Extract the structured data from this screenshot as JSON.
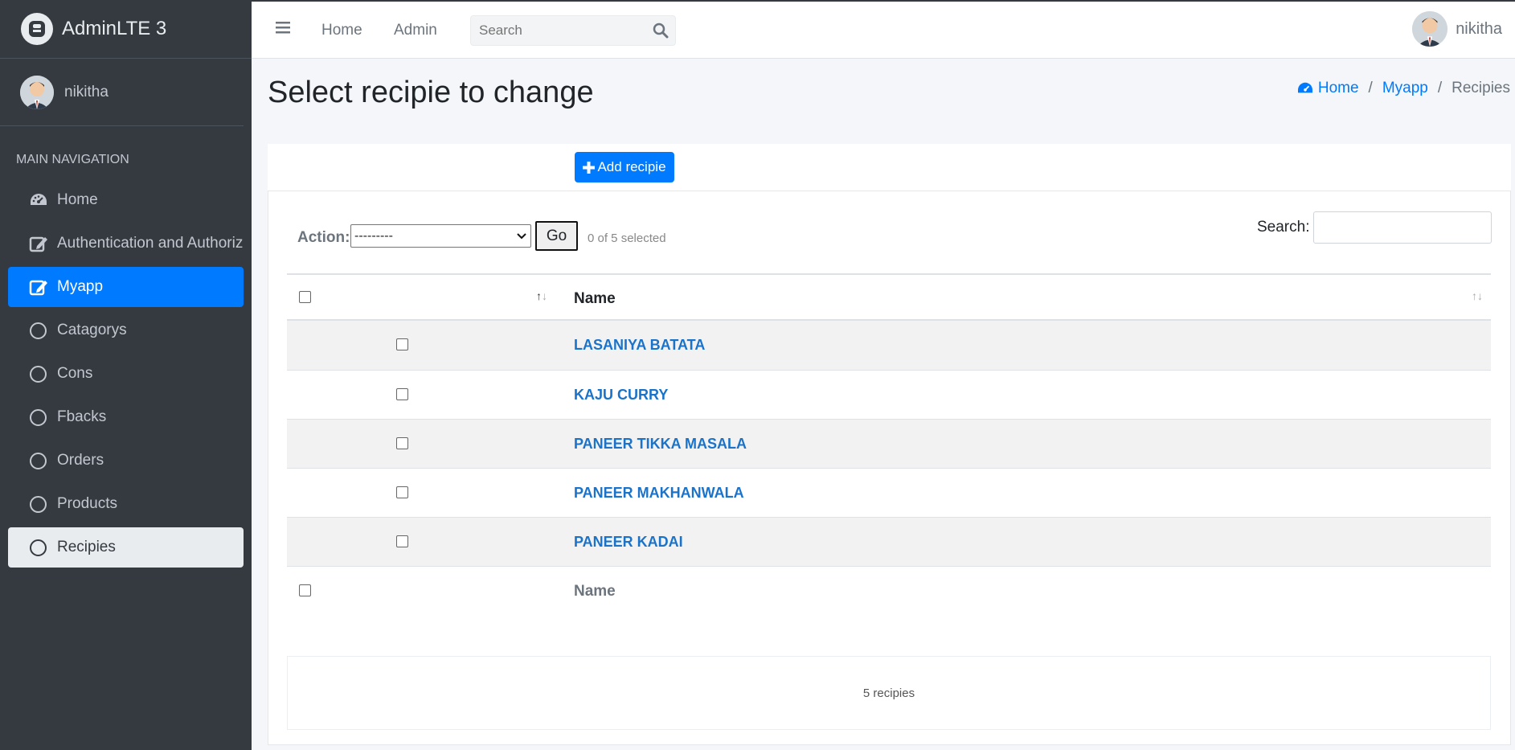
{
  "brand": {
    "title": "AdminLTE 3"
  },
  "user": {
    "name": "nikitha"
  },
  "sidebar": {
    "header": "MAIN NAVIGATION",
    "items": [
      {
        "label": "Home",
        "icon": "dashboard-icon"
      },
      {
        "label": "Authentication and Authoriz",
        "icon": "edit-icon"
      },
      {
        "label": "Myapp",
        "icon": "edit-icon"
      },
      {
        "label": "Catagorys",
        "icon": "circle-icon"
      },
      {
        "label": "Cons",
        "icon": "circle-icon"
      },
      {
        "label": "Fbacks",
        "icon": "circle-icon"
      },
      {
        "label": "Orders",
        "icon": "circle-icon"
      },
      {
        "label": "Products",
        "icon": "circle-icon"
      },
      {
        "label": "Recipies",
        "icon": "circle-icon"
      }
    ]
  },
  "topbar": {
    "links": [
      "Home",
      "Admin"
    ],
    "search_placeholder": "Search",
    "user": "nikitha"
  },
  "page": {
    "title": "Select recipie to change"
  },
  "breadcrumb": [
    "Home",
    "Myapp",
    "Recipies"
  ],
  "toolbar": {
    "add_label": "Add recipie",
    "action_label": "Action:",
    "action_value": "---------",
    "go_label": "Go",
    "selected": "0 of 5 selected",
    "search_label": "Search:"
  },
  "table": {
    "header": "Name",
    "rows": [
      "LASANIYA BATATA",
      "KAJU CURRY",
      "PANEER TIKKA MASALA",
      "PANEER MAKHANWALA",
      "PANEER KADAI"
    ],
    "footer_header": "Name"
  },
  "summary": "5 recipies",
  "colors": {
    "accent": "#007bff",
    "sidebar": "#343a40"
  }
}
